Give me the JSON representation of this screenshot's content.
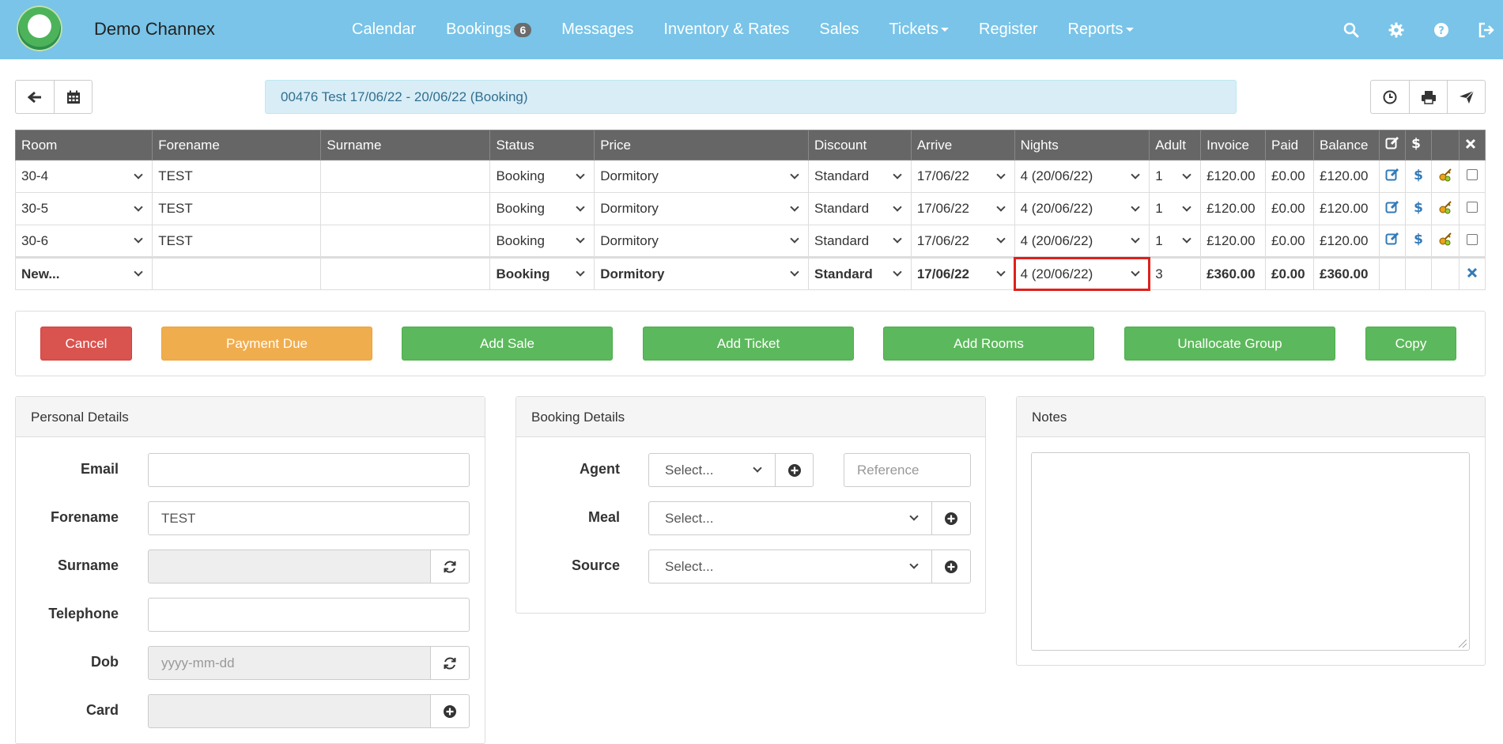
{
  "navbar": {
    "brand": "Demo Channex",
    "links": [
      {
        "label": "Calendar"
      },
      {
        "label": "Bookings",
        "badge": "6"
      },
      {
        "label": "Messages"
      },
      {
        "label": "Inventory & Rates"
      },
      {
        "label": "Sales"
      },
      {
        "label": "Tickets",
        "dropdown": true
      },
      {
        "label": "Register"
      },
      {
        "label": "Reports",
        "dropdown": true
      }
    ],
    "icons": [
      "search-icon",
      "gear-icon",
      "help-icon",
      "logout-icon"
    ],
    "color": "#79c4e8"
  },
  "toolbar": {
    "back_icon": "arrow-left-icon",
    "calendar_icon": "calendar-icon",
    "title": "00476  Test  17/06/22 - 20/06/22  (Booking)",
    "right_icons": [
      "clock-icon",
      "print-icon",
      "send-icon"
    ]
  },
  "table": {
    "headers": [
      "Room",
      "Forename",
      "Surname",
      "Status",
      "Price",
      "Discount",
      "Arrive",
      "Nights",
      "Adult",
      "Invoice",
      "Paid",
      "Balance"
    ],
    "rows": [
      {
        "room": "30-4",
        "forename": "TEST",
        "surname": "",
        "status": "Booking",
        "price": "Dormitory",
        "discount": "Standard",
        "arrive": "17/06/22",
        "nights": "4 (20/06/22)",
        "adult": "1",
        "invoice": "£120.00",
        "paid": "£0.00",
        "balance": "£120.00"
      },
      {
        "room": "30-5",
        "forename": "TEST",
        "surname": "",
        "status": "Booking",
        "price": "Dormitory",
        "discount": "Standard",
        "arrive": "17/06/22",
        "nights": "4 (20/06/22)",
        "adult": "1",
        "invoice": "£120.00",
        "paid": "£0.00",
        "balance": "£120.00"
      },
      {
        "room": "30-6",
        "forename": "TEST",
        "surname": "",
        "status": "Booking",
        "price": "Dormitory",
        "discount": "Standard",
        "arrive": "17/06/22",
        "nights": "4 (20/06/22)",
        "adult": "1",
        "invoice": "£120.00",
        "paid": "£0.00",
        "balance": "£120.00"
      }
    ],
    "new_row": {
      "room": "New...",
      "status": "Booking",
      "price": "Dormitory",
      "discount": "Standard",
      "arrive": "17/06/22",
      "nights": "4 (20/06/22)",
      "adult": "3",
      "invoice": "£360.00",
      "paid": "£0.00",
      "balance": "£360.00"
    }
  },
  "actions": {
    "cancel": "Cancel",
    "payment_due": "Payment Due",
    "add_sale": "Add Sale",
    "add_ticket": "Add Ticket",
    "add_rooms": "Add Rooms",
    "unallocate_group": "Unallocate Group",
    "copy": "Copy"
  },
  "personal": {
    "title": "Personal Details",
    "email_label": "Email",
    "email_value": "",
    "forename_label": "Forename",
    "forename_value": "TEST",
    "surname_label": "Surname",
    "surname_value": "",
    "telephone_label": "Telephone",
    "telephone_value": "",
    "dob_label": "Dob",
    "dob_placeholder": "yyyy-mm-dd",
    "card_label": "Card",
    "card_value": ""
  },
  "booking": {
    "title": "Booking Details",
    "agent_label": "Agent",
    "agent_value": "Select...",
    "reference_placeholder": "Reference",
    "meal_label": "Meal",
    "meal_value": "Select...",
    "source_label": "Source",
    "source_value": "Select..."
  },
  "notes": {
    "title": "Notes",
    "value": ""
  }
}
